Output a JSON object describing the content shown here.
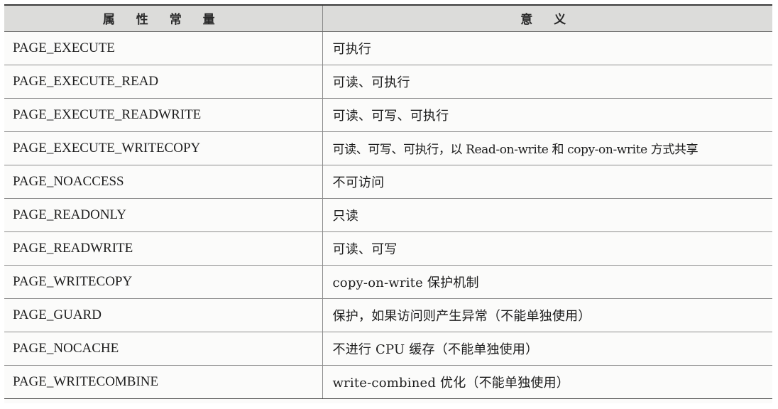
{
  "table": {
    "headers": [
      "属 性 常 量",
      "意 义"
    ],
    "rows": [
      [
        "PAGE_EXECUTE",
        "可执行"
      ],
      [
        "PAGE_EXECUTE_READ",
        "可读、可执行"
      ],
      [
        "PAGE_EXECUTE_READWRITE",
        "可读、可写、可执行"
      ],
      [
        "PAGE_EXECUTE_WRITECOPY",
        "可读、可写、可执行，以 Read-on-write 和 copy-on-write 方式共享"
      ],
      [
        "PAGE_NOACCESS",
        "不可访问"
      ],
      [
        "PAGE_READONLY",
        "只读"
      ],
      [
        "PAGE_READWRITE",
        "可读、可写"
      ],
      [
        "PAGE_WRITECOPY",
        "copy-on-write 保护机制"
      ],
      [
        "PAGE_GUARD",
        "保护，如果访问则产生异常（不能单独使用）"
      ],
      [
        "PAGE_NOCACHE",
        "不进行 CPU 缓存（不能单独使用）"
      ],
      [
        "PAGE_WRITECOMBINE",
        "write-combined 优化（不能单独使用）"
      ]
    ]
  }
}
